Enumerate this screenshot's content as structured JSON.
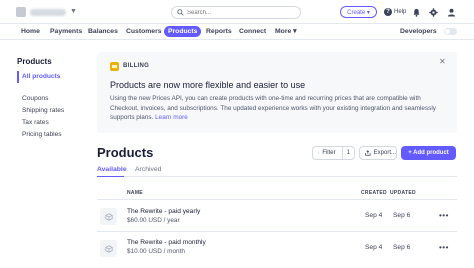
{
  "topbar": {
    "search_placeholder": "Search...",
    "create_label": "Create ▾",
    "help_label": "Help",
    "icons": [
      "bell-icon",
      "gear-icon",
      "user-icon"
    ]
  },
  "nav": {
    "items": [
      "Home",
      "Payments",
      "Balances",
      "Customers",
      "Products",
      "Reports",
      "Connect",
      "More ▾"
    ],
    "active": "Products",
    "developers_label": "Developers"
  },
  "sidebar": {
    "title": "Products",
    "items": [
      "All products",
      "Coupons",
      "Shipping rates",
      "Tax rates",
      "Pricing tables"
    ],
    "active": "All products"
  },
  "banner": {
    "label": "BILLING",
    "title": "Products are now more flexible and easier to use",
    "body": "Using the new Prices API, you can create products with one-time and recurring prices that are compatible with Checkout, invoices, and subscriptions. The updated experience works with your existing integration and seamlessly supports plans.",
    "link": "Learn more"
  },
  "page": {
    "title": "Products",
    "filter_label": "Filter",
    "filter_count": "1",
    "export_label": "Export...",
    "add_label": "+ Add product",
    "tabs": [
      "Available",
      "Archived"
    ],
    "active_tab": "Available"
  },
  "table": {
    "headers": {
      "name": "NAME",
      "created": "CREATED",
      "updated": "UPDATED"
    },
    "rows": [
      {
        "name": "The Rewrite - paid yearly",
        "price": "$60.00 USD / year",
        "created": "Sep 4",
        "updated": "Sep 6"
      },
      {
        "name": "The Rewrite - paid monthly",
        "price": "$10.00 USD / month",
        "created": "Sep 4",
        "updated": "Sep 6"
      }
    ]
  },
  "colors": {
    "accent": "#635bff",
    "billing": "#e9b10e"
  }
}
